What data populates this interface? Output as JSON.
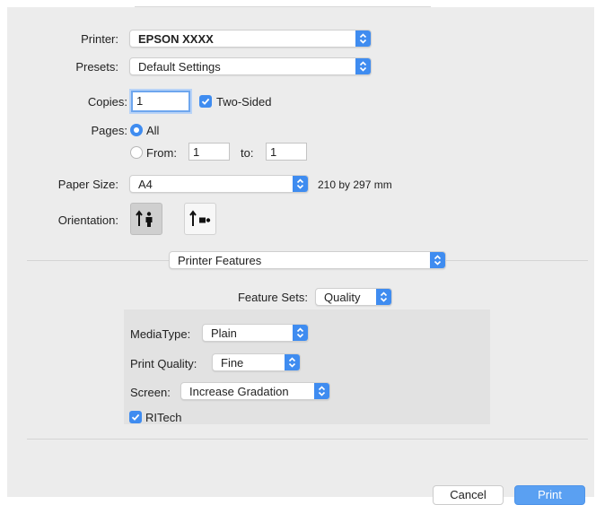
{
  "printer": {
    "label": "Printer:",
    "value": "EPSON XXXX"
  },
  "presets": {
    "label": "Presets:",
    "value": "Default Settings"
  },
  "copies": {
    "label": "Copies:",
    "value": "1"
  },
  "two_sided": {
    "label": "Two-Sided",
    "checked": true
  },
  "pages": {
    "label": "Pages:",
    "all_label": "All",
    "from_label": "From:",
    "from_value": "1",
    "to_label": "to:",
    "to_value": "1",
    "selected": "All"
  },
  "paper_size": {
    "label": "Paper Size:",
    "value": "A4",
    "dimensions": "210 by 297 mm"
  },
  "orientation": {
    "label": "Orientation:",
    "options": [
      "portrait",
      "landscape"
    ],
    "selected": "portrait"
  },
  "section": {
    "value": "Printer Features"
  },
  "feature_sets": {
    "label": "Feature Sets:",
    "value": "Quality"
  },
  "media_type": {
    "label": "MediaType:",
    "value": "Plain"
  },
  "print_quality": {
    "label": "Print Quality:",
    "value": "Fine"
  },
  "screen": {
    "label": "Screen:",
    "value": "Increase Gradation"
  },
  "ritech": {
    "label": "RITech",
    "checked": true
  },
  "buttons": {
    "cancel": "Cancel",
    "print": "Print"
  },
  "colors": {
    "accent": "#3f8cf0",
    "print_button": "#5aa0f2",
    "background": "#ececec",
    "panel": "#e2e2e2"
  }
}
